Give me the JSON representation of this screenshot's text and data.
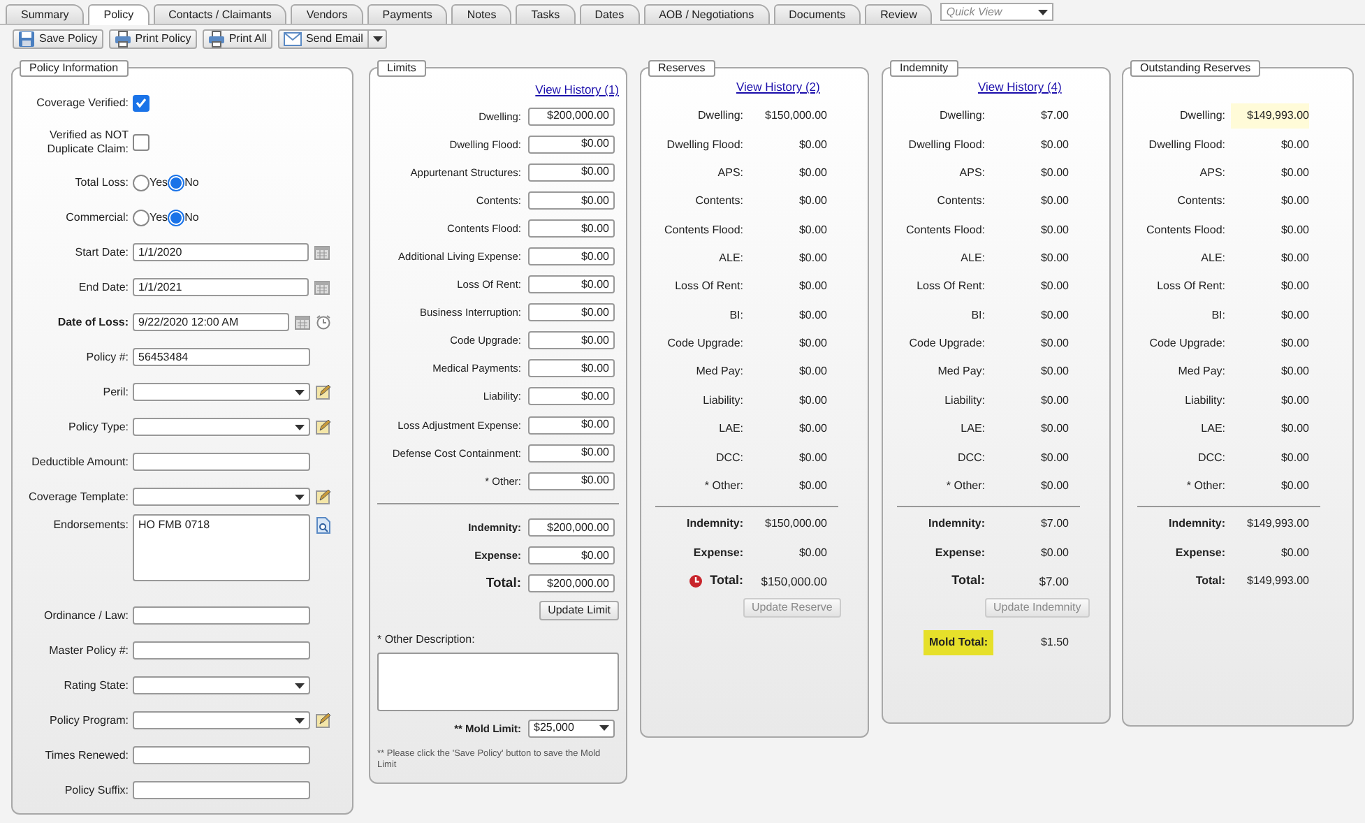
{
  "tabs": [
    {
      "label": "Summary",
      "selected": false
    },
    {
      "label": "Policy",
      "selected": true
    },
    {
      "label": "Contacts / Claimants",
      "selected": false
    },
    {
      "label": "Vendors",
      "selected": false
    },
    {
      "label": "Payments",
      "selected": false
    },
    {
      "label": "Notes",
      "selected": false
    },
    {
      "label": "Tasks",
      "selected": false
    },
    {
      "label": "Dates",
      "selected": false
    },
    {
      "label": "AOB / Negotiations",
      "selected": false
    },
    {
      "label": "Documents",
      "selected": false
    },
    {
      "label": "Review",
      "selected": false
    }
  ],
  "quick_view": {
    "placeholder": "Quick View"
  },
  "toolbar": [
    {
      "label": "Save Policy",
      "kind": "save",
      "menu": false
    },
    {
      "label": "Print Policy",
      "kind": "print",
      "menu": false
    },
    {
      "label": "Print All",
      "kind": "print",
      "menu": false
    },
    {
      "label": "Send Email",
      "kind": "email",
      "menu": true
    }
  ],
  "policy_information": {
    "title": "Policy Information",
    "fields": [
      {
        "label": "Coverage Verified:",
        "kind": "checkbox",
        "checked": true
      },
      {
        "label": "Verified as NOT Duplicate Claim:",
        "kind": "checkbox",
        "checked": false
      },
      {
        "label": "Total Loss:",
        "kind": "radio",
        "options": [
          {
            "label": "Yes",
            "selected": false
          },
          {
            "label": "No",
            "selected": true
          }
        ]
      },
      {
        "label": "Commercial:",
        "kind": "radio",
        "options": [
          {
            "label": "Yes",
            "selected": false
          },
          {
            "label": "No",
            "selected": true
          }
        ]
      },
      {
        "label": "Start Date:",
        "kind": "date",
        "value": "1/1/2020"
      },
      {
        "label": "End Date:",
        "kind": "date",
        "value": "1/1/2021"
      },
      {
        "label": "Date of Loss:",
        "kind": "datetime",
        "value": "9/22/2020 12:00 AM",
        "bold": true
      },
      {
        "label": "Policy #:",
        "kind": "text",
        "value": "56453484"
      },
      {
        "label": "Peril:",
        "kind": "select",
        "has_button": true
      },
      {
        "label": "Policy Type:",
        "kind": "select",
        "has_button": true
      },
      {
        "label": "Deductible Amount:",
        "kind": "text"
      },
      {
        "label": "Coverage Template:",
        "kind": "select",
        "has_button": true
      },
      {
        "label": "Endorsements:",
        "kind": "textarea",
        "value": "HO FMB 0718",
        "has_button": true
      },
      {
        "label": "Ordinance / Law:",
        "kind": "text"
      },
      {
        "label": "Master Policy #:",
        "kind": "text"
      },
      {
        "label": "Rating State:",
        "kind": "select",
        "has_button": false
      },
      {
        "label": "Policy Program:",
        "kind": "select",
        "has_button": true
      },
      {
        "label": "Times Renewed:",
        "kind": "text"
      },
      {
        "label": "Policy Suffix:",
        "kind": "text"
      }
    ]
  },
  "limits": {
    "title": "Limits",
    "history_link": "View History (1)",
    "rows": [
      {
        "label": "Dwelling:",
        "value": "$200,000.00"
      },
      {
        "label": "Dwelling Flood:",
        "value": "$0.00"
      },
      {
        "label": "Appurtenant Structures:",
        "value": "$0.00"
      },
      {
        "label": "Contents:",
        "value": "$0.00"
      },
      {
        "label": "Contents Flood:",
        "value": "$0.00"
      },
      {
        "label": "Additional Living Expense:",
        "value": "$0.00"
      },
      {
        "label": "Loss Of Rent:",
        "value": "$0.00"
      },
      {
        "label": "Business Interruption:",
        "value": "$0.00"
      },
      {
        "label": "Code Upgrade:",
        "value": "$0.00"
      },
      {
        "label": "Medical Payments:",
        "value": "$0.00"
      },
      {
        "label": "Liability:",
        "value": "$0.00"
      },
      {
        "label": "Loss Adjustment Expense:",
        "value": "$0.00"
      },
      {
        "label": "Defense Cost Containment:",
        "value": "$0.00"
      },
      {
        "label": "* Other:",
        "value": "$0.00"
      }
    ],
    "totals": [
      {
        "label": "Indemnity:",
        "value": "$200,000.00",
        "kind": "subtotal"
      },
      {
        "label": "Expense:",
        "value": "$0.00",
        "kind": "subtotal"
      },
      {
        "label": "Total:",
        "value": "$200,000.00",
        "kind": "total"
      }
    ],
    "button": "Update Limit",
    "other_description": {
      "label": "* Other Description:"
    },
    "mold_limit": {
      "label": "** Mold Limit:",
      "value": "$25,000"
    },
    "note": "** Please click the 'Save Policy' button to save the Mold Limit"
  },
  "reserves": {
    "title": "Reserves",
    "history_link": "View History (2)",
    "rows": [
      {
        "label": "Dwelling:",
        "value": "$150,000.00"
      },
      {
        "label": "Dwelling Flood:",
        "value": "$0.00"
      },
      {
        "label": "APS:",
        "value": "$0.00"
      },
      {
        "label": "Contents:",
        "value": "$0.00"
      },
      {
        "label": "Contents Flood:",
        "value": "$0.00"
      },
      {
        "label": "ALE:",
        "value": "$0.00"
      },
      {
        "label": "Loss Of Rent:",
        "value": "$0.00"
      },
      {
        "label": "BI:",
        "value": "$0.00"
      },
      {
        "label": "Code Upgrade:",
        "value": "$0.00"
      },
      {
        "label": "Med Pay:",
        "value": "$0.00"
      },
      {
        "label": "Liability:",
        "value": "$0.00"
      },
      {
        "label": "LAE:",
        "value": "$0.00"
      },
      {
        "label": "DCC:",
        "value": "$0.00"
      },
      {
        "label": "* Other:",
        "value": "$0.00"
      }
    ],
    "totals": [
      {
        "label": "Indemnity:",
        "value": "$150,000.00",
        "kind": "subtotal"
      },
      {
        "label": "Expense:",
        "value": "$0.00",
        "kind": "subtotal"
      },
      {
        "label": "Total:",
        "value": "$150,000.00",
        "kind": "total",
        "warning": true
      }
    ],
    "button": {
      "label": "Update Reserve",
      "disabled": true
    }
  },
  "indemnity": {
    "title": "Indemnity",
    "history_link": "View History (4)",
    "rows": [
      {
        "label": "Dwelling:",
        "value": "$7.00"
      },
      {
        "label": "Dwelling Flood:",
        "value": "$0.00"
      },
      {
        "label": "APS:",
        "value": "$0.00"
      },
      {
        "label": "Contents:",
        "value": "$0.00"
      },
      {
        "label": "Contents Flood:",
        "value": "$0.00"
      },
      {
        "label": "ALE:",
        "value": "$0.00"
      },
      {
        "label": "Loss Of Rent:",
        "value": "$0.00"
      },
      {
        "label": "BI:",
        "value": "$0.00"
      },
      {
        "label": "Code Upgrade:",
        "value": "$0.00"
      },
      {
        "label": "Med Pay:",
        "value": "$0.00"
      },
      {
        "label": "Liability:",
        "value": "$0.00"
      },
      {
        "label": "LAE:",
        "value": "$0.00"
      },
      {
        "label": "DCC:",
        "value": "$0.00"
      },
      {
        "label": "* Other:",
        "value": "$0.00"
      }
    ],
    "totals": [
      {
        "label": "Indemnity:",
        "value": "$7.00",
        "kind": "subtotal"
      },
      {
        "label": "Expense:",
        "value": "$0.00",
        "kind": "subtotal"
      },
      {
        "label": "Total:",
        "value": "$7.00",
        "kind": "total"
      }
    ],
    "button": {
      "label": "Update Indemnity",
      "disabled": true
    },
    "mold_total": {
      "label": "Mold Total:",
      "value": "$1.50",
      "highlighted": true
    }
  },
  "outstanding_reserves": {
    "title": "Outstanding Reserves",
    "rows": [
      {
        "label": "Dwelling:",
        "value": "$149,993.00",
        "highlighted": true
      },
      {
        "label": "Dwelling Flood:",
        "value": "$0.00"
      },
      {
        "label": "APS:",
        "value": "$0.00"
      },
      {
        "label": "Contents:",
        "value": "$0.00"
      },
      {
        "label": "Contents Flood:",
        "value": "$0.00"
      },
      {
        "label": "ALE:",
        "value": "$0.00"
      },
      {
        "label": "Loss Of Rent:",
        "value": "$0.00"
      },
      {
        "label": "BI:",
        "value": "$0.00"
      },
      {
        "label": "Code Upgrade:",
        "value": "$0.00"
      },
      {
        "label": "Med Pay:",
        "value": "$0.00"
      },
      {
        "label": "Liability:",
        "value": "$0.00"
      },
      {
        "label": "LAE:",
        "value": "$0.00"
      },
      {
        "label": "DCC:",
        "value": "$0.00"
      },
      {
        "label": "* Other:",
        "value": "$0.00"
      }
    ],
    "totals": [
      {
        "label": "Indemnity:",
        "value": "$149,993.00"
      },
      {
        "label": "Expense:",
        "value": "$0.00"
      },
      {
        "label": "Total:",
        "value": "$149,993.00"
      }
    ]
  }
}
